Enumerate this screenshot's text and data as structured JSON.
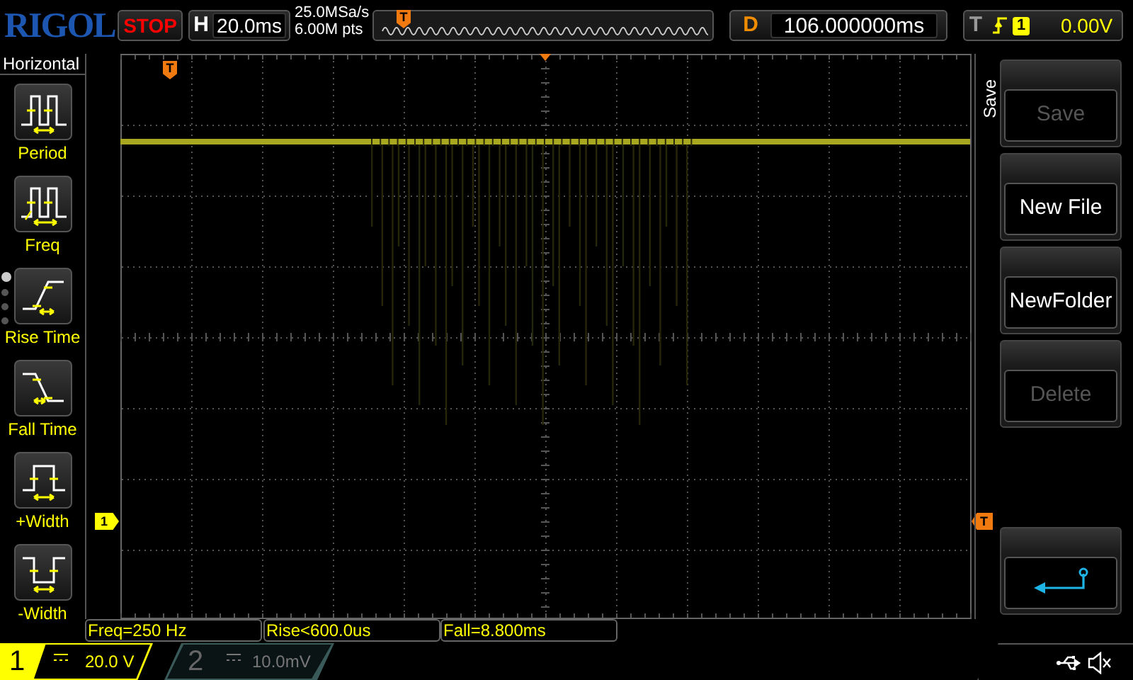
{
  "header": {
    "logo": "RIGOL",
    "run_state": "STOP",
    "timebase_label": "H",
    "timebase": "20.0ms",
    "sample_rate": "25.0MSa/s",
    "memory_depth": "6.00M pts",
    "memory_trigger_marker": "T",
    "delay_label": "D",
    "delay": "106.000000ms",
    "trigger_label": "T",
    "trigger_source": "1",
    "trigger_level": "0.00V"
  },
  "left_menu": {
    "title": "Horizontal",
    "items": [
      {
        "label": "Period",
        "kind": "period"
      },
      {
        "label": "Freq",
        "kind": "freq"
      },
      {
        "label": "Rise Time",
        "kind": "rise"
      },
      {
        "label": "Fall Time",
        "kind": "fall"
      },
      {
        "label": "+Width",
        "kind": "pwidth"
      },
      {
        "label": "-Width",
        "kind": "nwidth"
      }
    ],
    "page_dots": [
      {
        "selected": true
      },
      {
        "selected": false
      },
      {
        "selected": false
      },
      {
        "selected": false
      }
    ]
  },
  "screen": {
    "trigger_position_marker": "T",
    "channel_marker": "1",
    "trigger_level_marker": "T"
  },
  "right_menu": {
    "title": "Save",
    "buttons": [
      {
        "kind": "text",
        "label": "Save",
        "disabled": true
      },
      {
        "kind": "text",
        "label": "New File",
        "disabled": false
      },
      {
        "kind": "text",
        "label": "NewFolder",
        "disabled": false
      },
      {
        "kind": "text",
        "label": "Delete",
        "disabled": true
      },
      {
        "kind": "back"
      }
    ]
  },
  "measurements": [
    "Freq=250 Hz",
    "Rise<600.0us",
    "Fall=8.800ms"
  ],
  "channels": [
    {
      "number": "1",
      "scale": "20.0 V",
      "on": true
    },
    {
      "number": "2",
      "scale": "10.0mV",
      "on": false
    }
  ]
}
